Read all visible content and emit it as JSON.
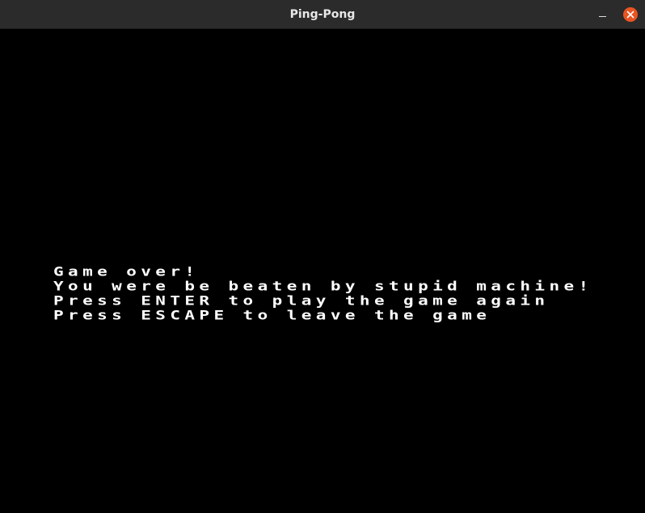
{
  "window": {
    "title": "Ping-Pong"
  },
  "colors": {
    "titlebar": "#2b2b2b",
    "close_button": "#e95420",
    "background": "#000000",
    "text": "#ffffff"
  },
  "icons": {
    "minimize": "minimize-icon",
    "close": "close-icon"
  },
  "game": {
    "lines": [
      "Game over!",
      "You were be beaten by stupid machine!",
      "Press ENTER to play the game again",
      "Press ESCAPE to leave the game"
    ]
  }
}
